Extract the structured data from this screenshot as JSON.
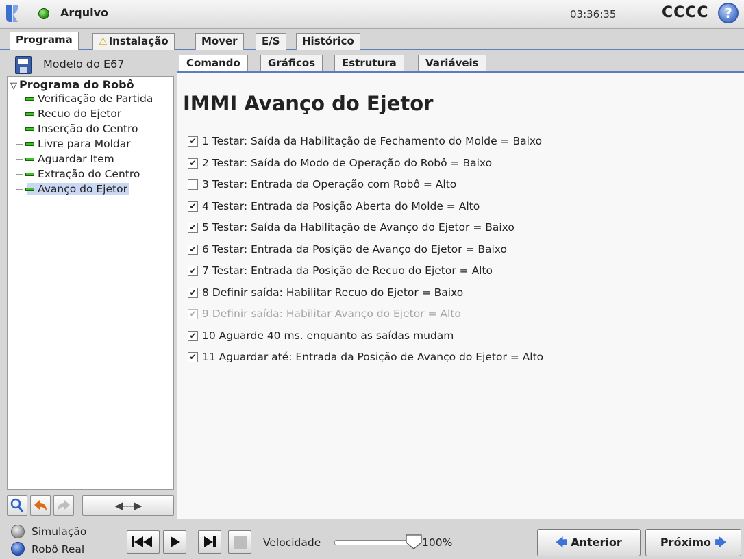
{
  "titlebar": {
    "menu_label": "Arquivo",
    "clock": "03:36:35",
    "robot_name": "CCCC",
    "help_label": "?"
  },
  "main_tabs": [
    {
      "label": "Programa",
      "active": true
    },
    {
      "label": "Instalação",
      "warning": true
    },
    {
      "label": "Mover"
    },
    {
      "label": "E/S"
    },
    {
      "label": "Histórico"
    }
  ],
  "left_panel": {
    "program_name": "Modelo do E67",
    "tree_root": "Programa do Robô",
    "tree_items": [
      "Verificação de Partida",
      "Recuo do Ejetor",
      "Inserção do Centro",
      "Livre para Moldar",
      "Aguardar Item",
      "Extração do Centro",
      "Avanço do Ejetor"
    ],
    "selected_index": 6,
    "move_button_label": "◀----▶"
  },
  "content_tabs": [
    {
      "label": "Comando",
      "active": true
    },
    {
      "label": "Gráficos"
    },
    {
      "label": "Estrutura"
    },
    {
      "label": "Variáveis"
    }
  ],
  "content": {
    "title": "IMMI Avanço do Ejetor",
    "commands": [
      {
        "text": "1 Testar: Saída da Habilitação de Fechamento do Molde = Baixo",
        "checked": true,
        "disabled": false
      },
      {
        "text": "2 Testar: Saída do Modo de Operação do Robô = Baixo",
        "checked": true,
        "disabled": false
      },
      {
        "text": "3 Testar: Entrada da Operação com Robô = Alto",
        "checked": false,
        "disabled": false
      },
      {
        "text": "4 Testar: Entrada da Posição Aberta do Molde = Alto",
        "checked": true,
        "disabled": false
      },
      {
        "text": "5 Testar: Saída da Habilitação de Avanço do Ejetor = Baixo",
        "checked": true,
        "disabled": false
      },
      {
        "text": "6 Testar: Entrada da Posição de Avanço do Ejetor = Baixo",
        "checked": true,
        "disabled": false
      },
      {
        "text": "7 Testar: Entrada da Posição de Recuo do Ejetor = Alto",
        "checked": true,
        "disabled": false
      },
      {
        "text": "8 Definir saída: Habilitar Recuo do Ejetor = Baixo",
        "checked": true,
        "disabled": false
      },
      {
        "text": "9 Definir saída: Habilitar Avanço do Ejetor = Alto",
        "checked": true,
        "disabled": true
      },
      {
        "text": "10 Aguarde 40 ms. enquanto as saídas mudam",
        "checked": true,
        "disabled": false
      },
      {
        "text": "11 Aguardar até: Entrada da Posição de Avanço do Ejetor = Alto",
        "checked": true,
        "disabled": false
      }
    ]
  },
  "footer": {
    "mode_simulation": "Simulação",
    "mode_real": "Robô Real",
    "speed_label": "Velocidade",
    "speed_value": "100%",
    "speed_fraction": 1.0,
    "prev_label": "Anterior",
    "next_label": "Próximo",
    "prev_arrow": "🡄",
    "next_arrow": "🡆"
  },
  "colors": {
    "accent": "#5a7fc0",
    "status_ok": "#2e9a16",
    "selection": "#c9d8f3",
    "warning": "#d6a000"
  }
}
